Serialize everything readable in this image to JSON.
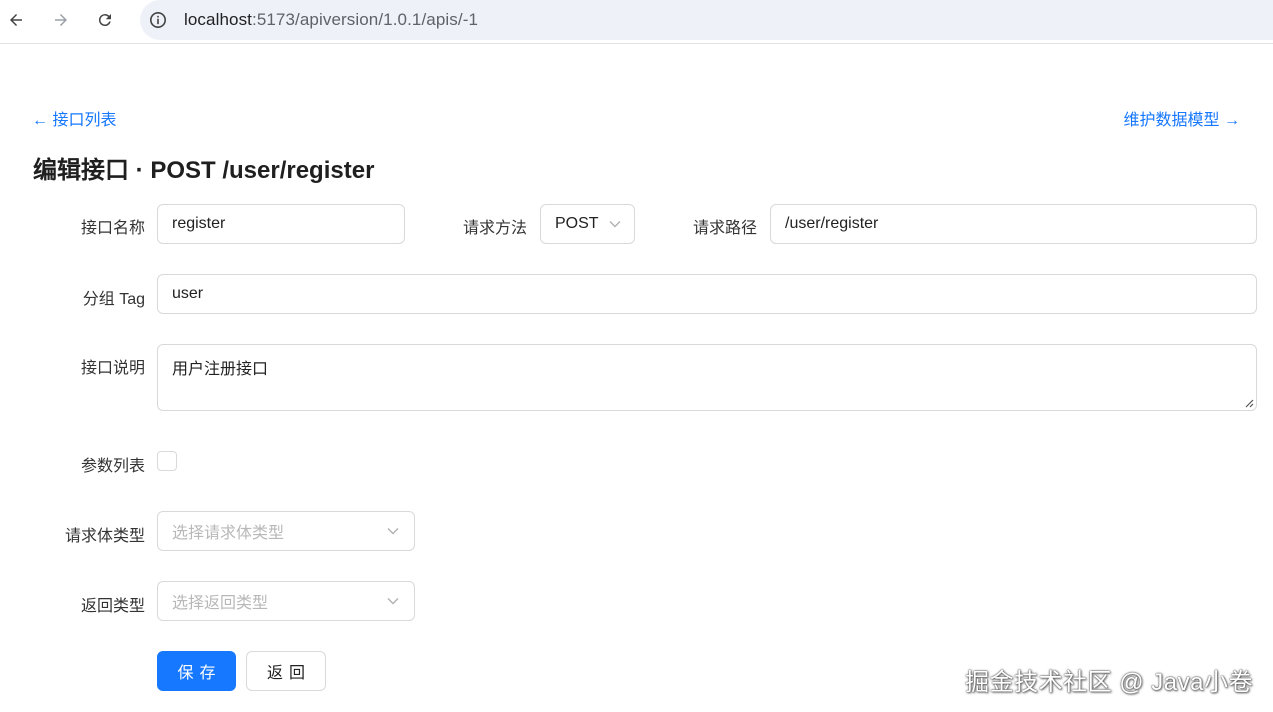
{
  "browser": {
    "url_host": "localhost",
    "url_path": ":5173/apiversion/1.0.1/apis/-1"
  },
  "page": {
    "back_link": "← 接口列表",
    "model_link": "维护数据模型 →",
    "title": "编辑接口 · POST /user/register"
  },
  "form": {
    "name_label": "接口名称",
    "name_value": "register",
    "method_label": "请求方法",
    "method_value": "POST",
    "path_label": "请求路径",
    "path_value": "/user/register",
    "tag_label": "分组 Tag",
    "tag_value": "user",
    "desc_label": "接口说明",
    "desc_value": "用户注册接口",
    "params_label": "参数列表",
    "body_type_label": "请求体类型",
    "body_type_placeholder": "选择请求体类型",
    "return_type_label": "返回类型",
    "return_type_placeholder": "选择返回类型"
  },
  "actions": {
    "save_label": "保存",
    "back_label": "返回"
  },
  "watermark": "掘金技术社区 @ Java小卷",
  "colors": {
    "accent": "#1677ff",
    "border": "#d9d9d9",
    "placeholder": "#b8b8b8"
  }
}
